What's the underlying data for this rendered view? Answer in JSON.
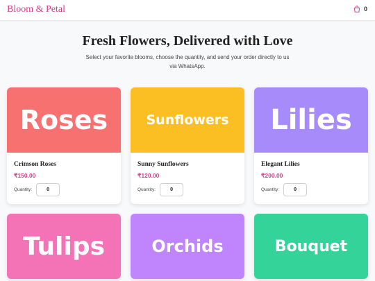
{
  "header": {
    "brand": "Bloom & Petal",
    "cart_count": "0"
  },
  "hero": {
    "title": "Fresh Flowers, Delivered with Love",
    "subtitle": "Select your favorite blooms, choose the quantity, and send your order directly to us via WhatsApp."
  },
  "quantity_label": "Quantity:",
  "products": [
    {
      "image_label": "Roses",
      "name": "Crimson Roses",
      "price": "₹150.00",
      "quantity": "0",
      "color": "#f87171"
    },
    {
      "image_label": "Sunflowers",
      "name": "Sunny Sunflowers",
      "price": "₹120.00",
      "quantity": "0",
      "color": "#fbbf24"
    },
    {
      "image_label": "Lilies",
      "name": "Elegant Lilies",
      "price": "₹200.00",
      "quantity": "0",
      "color": "#a78bfa"
    },
    {
      "image_label": "Tulips",
      "color": "#f472b6"
    },
    {
      "image_label": "Orchids",
      "color": "#c084fc"
    },
    {
      "image_label": "Bouquet",
      "color": "#34d399"
    }
  ],
  "colors": {
    "accent": "#d63b8a"
  }
}
